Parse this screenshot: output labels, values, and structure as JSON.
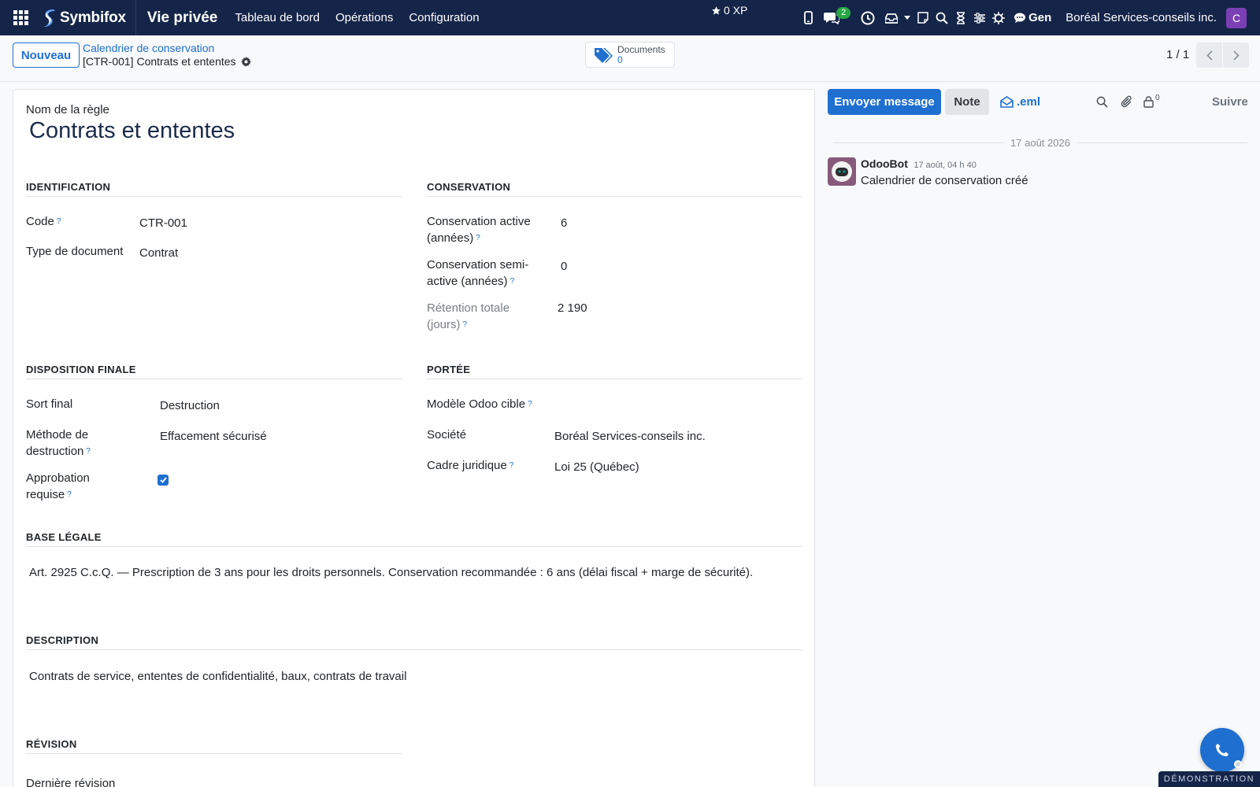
{
  "navbar": {
    "brand": "Symbifox",
    "app_name": "Vie privée",
    "menus": [
      "Tableau de bord",
      "Opérations",
      "Configuration"
    ],
    "xp": "0 XP",
    "messages_badge": "2",
    "gen_label": "Gen",
    "company": "Boréal Services-conseils inc.",
    "avatar_letter": "C",
    "avatar_color": "#7b3fb5",
    "icons": [
      "mobile-icon",
      "chat-icon",
      "clock-icon",
      "inbox-icon",
      "caret-icon",
      "note-icon",
      "search-icon",
      "hourglass-icon",
      "sliders-icon",
      "bug-icon"
    ]
  },
  "control": {
    "new_button": "Nouveau",
    "breadcrumb_parent": "Calendrier de conservation",
    "breadcrumb_current": "[CTR-001] Contrats et ententes",
    "smart_button_title": "Documents",
    "smart_button_value": "0",
    "pager": "1 / 1"
  },
  "form": {
    "name_label": "Nom de la règle",
    "name_value": "Contrats et ententes",
    "identification": {
      "title": "IDENTIFICATION",
      "code_label": "Code",
      "code_value": "CTR-001",
      "doctype_label": "Type de document",
      "doctype_value": "Contrat"
    },
    "conservation": {
      "title": "CONSERVATION",
      "active_label_1": "Conservation active",
      "active_label_2": "(années)",
      "active_value": "6",
      "semi_label_1": "Conservation semi-",
      "semi_label_2": "active (années)",
      "semi_value": "0",
      "total_label_1": "Rétention totale",
      "total_label_2": "(jours)",
      "total_value": "2 190"
    },
    "disposition": {
      "title": "DISPOSITION FINALE",
      "final_label": "Sort final",
      "final_value": "Destruction",
      "method_label_1": "Méthode de",
      "method_label_2": "destruction",
      "method_value": "Effacement sécurisé",
      "approval_label_1": "Approbation",
      "approval_label_2": "requise",
      "approval_checked": true
    },
    "scope": {
      "title": "PORTÉE",
      "model_label": "Modèle Odoo cible",
      "model_value": "",
      "company_label": "Société",
      "company_value": "Boréal Services-conseils inc.",
      "legal_label": "Cadre juridique",
      "legal_value": "Loi 25 (Québec)"
    },
    "legal_basis": {
      "title": "BASE LÉGALE",
      "text": "Art. 2925 C.c.Q. — Prescription de 3 ans pour les droits personnels. Conservation recommandée : 6 ans (délai fiscal + marge de sécurité)."
    },
    "description": {
      "title": "DESCRIPTION",
      "text": "Contrats de service, ententes de confidentialité, baux, contrats de travail"
    },
    "revision": {
      "title": "RÉVISION",
      "last_label": "Dernière révision"
    },
    "help_mark": "?"
  },
  "chatter": {
    "send_button": "Envoyer message",
    "note_button": "Note",
    "eml_button": ".eml",
    "followers_count": "0",
    "follow_button": "Suivre",
    "date_separator": "17 août 2026",
    "message": {
      "author": "OdooBot",
      "time": "17 août, 04 h 40",
      "text": "Calendrier de conservation créé"
    }
  },
  "demo_ribbon": "DÉMONSTRATION",
  "colors": {
    "navbar": "#152549",
    "primary": "#1f6fd0",
    "title": "#1c2a4a"
  }
}
